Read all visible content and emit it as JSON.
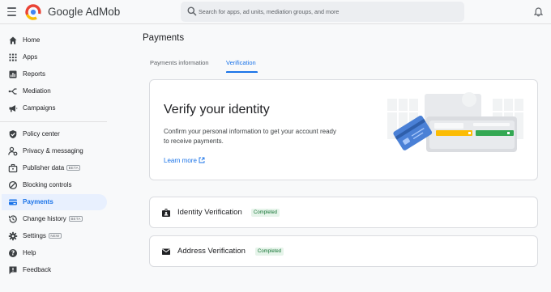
{
  "header": {
    "brand": "Google AdMob",
    "search_placeholder": "Search for apps, ad units, mediation groups, and more"
  },
  "sidebar": {
    "items": [
      {
        "label": "Home",
        "icon": "home-icon"
      },
      {
        "label": "Apps",
        "icon": "apps-grid-icon"
      },
      {
        "label": "Reports",
        "icon": "reports-icon"
      },
      {
        "label": "Mediation",
        "icon": "mediation-icon"
      },
      {
        "label": "Campaigns",
        "icon": "megaphone-icon"
      },
      {
        "label": "Policy center",
        "icon": "shield-check-icon"
      },
      {
        "label": "Privacy & messaging",
        "icon": "person-settings-icon"
      },
      {
        "label": "Publisher data",
        "icon": "briefcase-icon",
        "badge": "BETA"
      },
      {
        "label": "Blocking controls",
        "icon": "block-icon"
      },
      {
        "label": "Payments",
        "icon": "payments-icon",
        "active": true
      },
      {
        "label": "Change history",
        "icon": "history-icon",
        "badge": "BETA"
      },
      {
        "label": "Settings",
        "icon": "gear-icon",
        "badge": "NEW"
      },
      {
        "label": "Help",
        "icon": "help-icon"
      },
      {
        "label": "Feedback",
        "icon": "feedback-icon"
      }
    ]
  },
  "main": {
    "title": "Payments",
    "tabs": [
      {
        "label": "Payments information",
        "active": false
      },
      {
        "label": "Verification",
        "active": true
      }
    ],
    "hero": {
      "title": "Verify your identity",
      "description": "Confirm your personal information to get your account ready to receive payments.",
      "link": "Learn more"
    },
    "verifications": [
      {
        "label": "Identity Verification",
        "status": "Completed",
        "icon": "id-badge-icon"
      },
      {
        "label": "Address Verification",
        "status": "Completed",
        "icon": "mail-icon"
      }
    ]
  },
  "colors": {
    "accent": "#1a73e8",
    "active_nav_bg": "#e8f0fe",
    "status_text": "#137333",
    "status_bg": "#e6f4ea"
  }
}
